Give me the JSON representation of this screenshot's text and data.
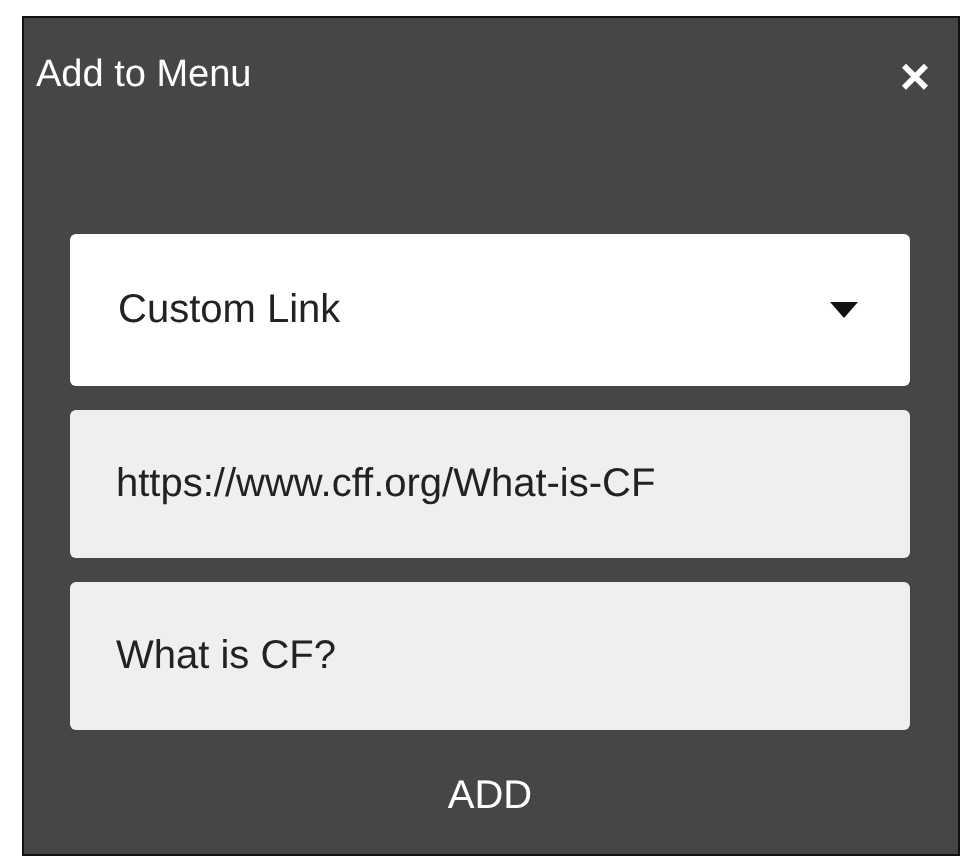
{
  "dialog": {
    "title": "Add to Menu",
    "close": "×"
  },
  "select": {
    "value": "Custom Link"
  },
  "fields": [
    {
      "value": "https://www.cff.org/What-is-CF"
    },
    {
      "value": "What is CF?"
    }
  ],
  "button": "ADD"
}
